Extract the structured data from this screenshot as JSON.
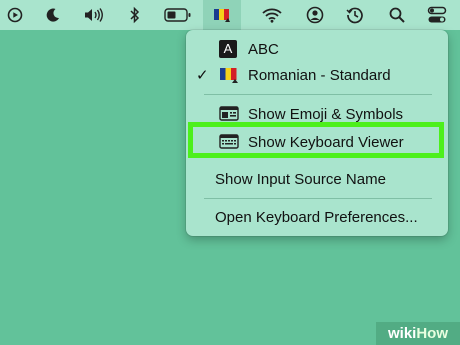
{
  "menubar": {
    "icons": [
      "play-circle-icon",
      "moon-icon",
      "volume-icon",
      "bluetooth-icon",
      "battery-icon",
      "input-flag-icon",
      "wifi-icon",
      "user-icon",
      "clock-history-icon",
      "search-icon",
      "control-center-icon"
    ],
    "bg_color": "#a9e4cd"
  },
  "menu": {
    "items": [
      {
        "label": "ABC",
        "icon": "abc-input-icon",
        "checked": false
      },
      {
        "label": "Romanian - Standard",
        "icon": "romanian-flag-icon",
        "checked": true,
        "check": "✓"
      },
      {
        "label": "Show Emoji & Symbols",
        "icon": "emoji-viewer-icon"
      },
      {
        "label": "Show Keyboard Viewer",
        "icon": "keyboard-viewer-icon",
        "highlighted": true
      },
      {
        "label": "Show Input Source Name"
      },
      {
        "label": "Open Keyboard Preferences..."
      }
    ],
    "abc_glyph": "A"
  },
  "highlight_color": "#4cf01b",
  "watermark": {
    "part1": "wiki",
    "part2": "How"
  },
  "colors": {
    "desktop": "#62c29a"
  }
}
